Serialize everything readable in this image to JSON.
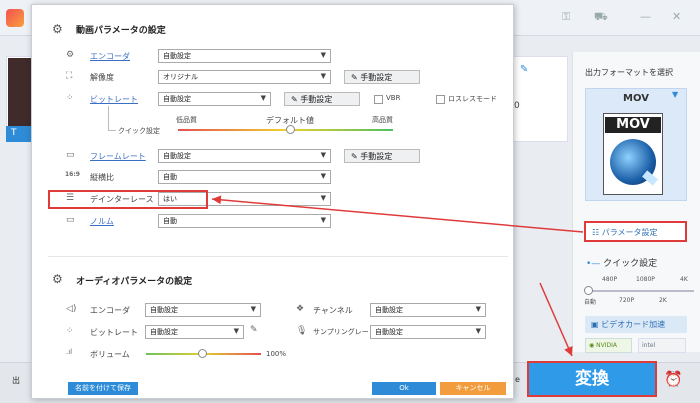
{
  "background": {
    "bottom_left_text": "出",
    "bottom_right_text": "e",
    "file_strip_text": "T",
    "zero_text": "0"
  },
  "right_panel": {
    "output_label": "出力フォーマットを選択",
    "format": "MOV",
    "format_icon_text": "MOV",
    "param_button": "パラメータ設定",
    "quick_label": "クイック設定",
    "quick_top_ticks": [
      "480P",
      "1080P",
      "4K"
    ],
    "quick_bottom_ticks": [
      "自動",
      "720P",
      "2K"
    ],
    "gpu_button": "ビデオカード加速",
    "nvidia": "NVIDIA",
    "intel": "intel",
    "convert_button": "変換"
  },
  "dialog": {
    "video_title": "動画パラメータの設定",
    "encoder": {
      "label": "エンコーダ",
      "value": "自動設定"
    },
    "resolution": {
      "label": "解像度",
      "value": "オリジナル",
      "button": "手動設定"
    },
    "bitrate": {
      "label": "ビットレート",
      "value": "自動設定",
      "button": "手動設定",
      "vbr": "VBR",
      "lossless": "ロスレスモード"
    },
    "quick": {
      "label": "クイック設定",
      "low": "低品質",
      "default": "デフォルト値",
      "high": "高品質"
    },
    "framerate": {
      "label": "フレームレート",
      "value": "自動設定",
      "button": "手動設定"
    },
    "aspect": {
      "label": "縦横比",
      "value": "自動"
    },
    "deinterlace": {
      "label": "デインターレース",
      "value": "はい"
    },
    "norm": {
      "label": "ノルム",
      "value": "自動"
    },
    "audio_title": "オーディオパラメータの設定",
    "a_encoder": {
      "label": "エンコーダ",
      "value": "自動設定"
    },
    "channel": {
      "label": "チャンネル",
      "value": "自動設定"
    },
    "a_bitrate": {
      "label": "ビットレート",
      "value": "自動設定"
    },
    "samplerate": {
      "label": "サンプリングレート",
      "value": "自動設定"
    },
    "volume": {
      "label": "ボリューム",
      "value": "100%",
      "level": 0.5
    },
    "save_preset": "名前を付けて保存",
    "ok": "Ok",
    "cancel": "キャンセル"
  },
  "colors": {
    "accent": "#2d8bd8",
    "highlight": "#e03b3b",
    "cancel": "#f39c3d"
  }
}
